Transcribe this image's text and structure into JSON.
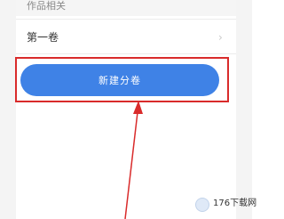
{
  "section": {
    "title": "作品相关"
  },
  "volume_list": [
    {
      "label": "第一卷",
      "chevron": "›"
    }
  ],
  "new_volume_button": {
    "label": "新建分卷"
  },
  "annotation": {
    "highlight_color": "#d92b2b",
    "arrow_color": "#d92b2b"
  },
  "watermark": {
    "text": "176下载网"
  },
  "colors": {
    "button_blue": "#3f82e6"
  }
}
